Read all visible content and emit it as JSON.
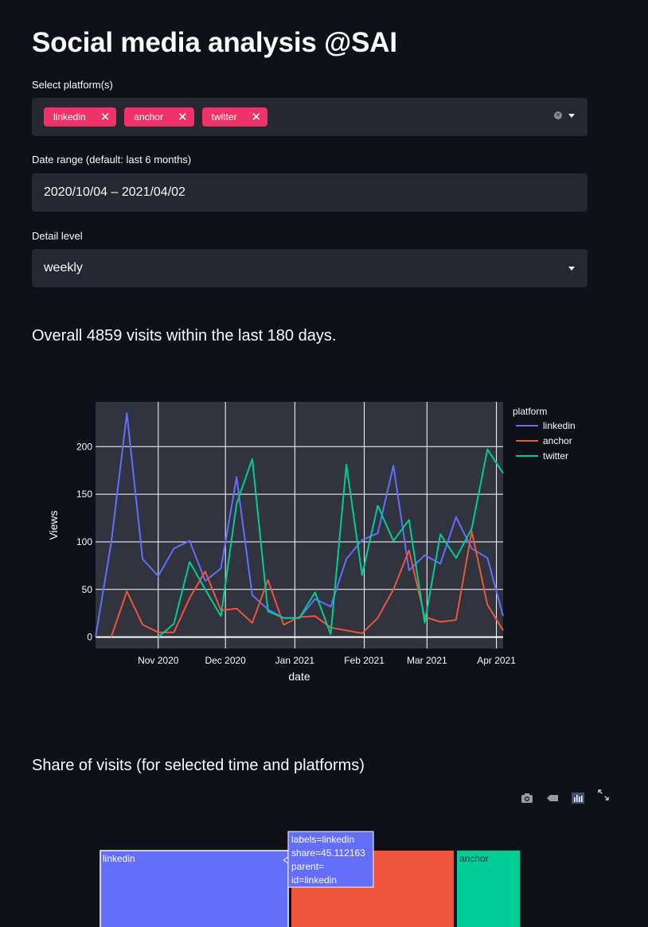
{
  "page": {
    "title": "Social media analysis @SAI"
  },
  "platform_select": {
    "label": "Select platform(s)",
    "chips": [
      {
        "label": "linkedin"
      },
      {
        "label": "anchor"
      },
      {
        "label": "twitter"
      }
    ]
  },
  "date_range": {
    "label": "Date range (default: last 6 months)",
    "value": "2020/10/04 – 2021/04/02"
  },
  "detail_level": {
    "label": "Detail level",
    "value": "weekly"
  },
  "summary": {
    "text": "Overall 4859 visits within the last 180 days."
  },
  "share": {
    "heading": "Share of visits (for selected time and platforms)"
  },
  "treemap": {
    "tiles": [
      {
        "label": "linkedin",
        "share": 45.112163,
        "color": "#636efa"
      },
      {
        "label": "",
        "share": 0,
        "color": "#ef553b"
      },
      {
        "label": "anchor",
        "share": 0,
        "color": "#00cc96"
      }
    ],
    "tooltip": [
      "labels=linkedin",
      "share=45.112163",
      "parent=",
      "id=linkedin"
    ]
  },
  "chart_data": {
    "type": "line",
    "xlabel": "date",
    "ylabel": "Views",
    "legend_title": "platform",
    "legend_placement": "top-right",
    "grid": true,
    "ylim": [
      -12,
      247
    ],
    "xlim": [
      "2020-10-04",
      "2021-04-04"
    ],
    "x_ticks": [
      "Nov 2020",
      "Dec 2020",
      "Jan 2021",
      "Feb 2021",
      "Mar 2021",
      "Apr 2021"
    ],
    "y_ticks": [
      0,
      50,
      100,
      150,
      200
    ],
    "series": [
      {
        "name": "linkedin",
        "color": "#636efa",
        "x": [
          "2020-10-04",
          "2020-10-11",
          "2020-10-18",
          "2020-10-25",
          "2020-11-01",
          "2020-11-08",
          "2020-11-15",
          "2020-11-22",
          "2020-11-29",
          "2020-12-06",
          "2020-12-13",
          "2020-12-20",
          "2020-12-27",
          "2021-01-03",
          "2021-01-10",
          "2021-01-17",
          "2021-01-24",
          "2021-01-31",
          "2021-02-07",
          "2021-02-14",
          "2021-02-21",
          "2021-02-28",
          "2021-03-07",
          "2021-03-14",
          "2021-03-21",
          "2021-03-28",
          "2021-04-04"
        ],
        "y": [
          0,
          99,
          235,
          82,
          64,
          93,
          101,
          59,
          72,
          168,
          44,
          29,
          20,
          20,
          40,
          32,
          82,
          102,
          109,
          180,
          70,
          86,
          77,
          126,
          93,
          83,
          22
        ]
      },
      {
        "name": "anchor",
        "color": "#ef553b",
        "x": [
          "2020-10-11",
          "2020-10-18",
          "2020-10-25",
          "2020-11-01",
          "2020-11-08",
          "2020-11-15",
          "2020-11-22",
          "2020-11-29",
          "2020-12-06",
          "2020-12-13",
          "2020-12-20",
          "2020-12-27",
          "2021-01-03",
          "2021-01-10",
          "2021-01-17",
          "2021-01-24",
          "2021-01-31",
          "2021-02-07",
          "2021-02-14",
          "2021-02-21",
          "2021-02-28",
          "2021-03-07",
          "2021-03-14",
          "2021-03-21",
          "2021-03-28",
          "2021-04-04"
        ],
        "y": [
          0,
          48,
          13,
          5,
          5,
          41,
          69,
          28,
          30,
          15,
          60,
          13,
          21,
          22,
          10,
          7,
          4,
          20,
          50,
          91,
          21,
          16,
          18,
          111,
          34,
          7
        ]
      },
      {
        "name": "twitter",
        "color": "#00cc96",
        "x": [
          "2020-11-01",
          "2020-11-08",
          "2020-11-15",
          "2020-11-22",
          "2020-11-29",
          "2020-12-06",
          "2020-12-13",
          "2020-12-20",
          "2020-12-27",
          "2021-01-03",
          "2021-01-10",
          "2021-01-17",
          "2021-01-24",
          "2021-01-31",
          "2021-02-07",
          "2021-02-14",
          "2021-02-21",
          "2021-02-28",
          "2021-03-07",
          "2021-03-14",
          "2021-03-21",
          "2021-03-28",
          "2021-04-04"
        ],
        "y": [
          0,
          14,
          79,
          50,
          22,
          140,
          187,
          27,
          20,
          20,
          47,
          3,
          181,
          65,
          138,
          101,
          123,
          15,
          108,
          83,
          114,
          197,
          172
        ]
      }
    ]
  }
}
